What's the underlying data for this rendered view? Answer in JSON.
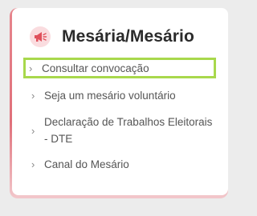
{
  "card": {
    "title": "Mesária/Mesário",
    "icon": "megaphone-icon",
    "accent_color": "#e0707a",
    "highlight_color": "#a8d84c",
    "items": [
      {
        "label": "Consultar convocação",
        "icon": "chevron-right-icon"
      },
      {
        "label": "Seja um mesário voluntário",
        "icon": "chevron-right-icon"
      },
      {
        "label": "Declaração de Trabalhos Eleitorais - DTE",
        "icon": "chevron-right-icon"
      },
      {
        "label": "Canal do Mesário",
        "icon": "chevron-right-icon"
      }
    ]
  }
}
